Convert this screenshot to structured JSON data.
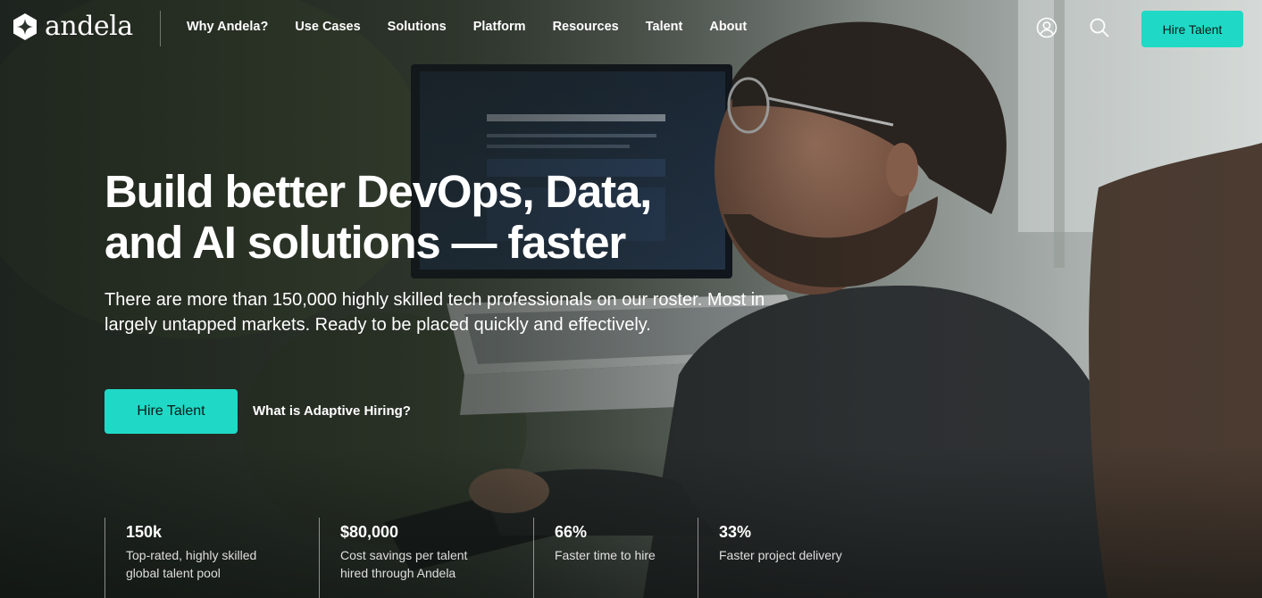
{
  "brand": {
    "name": "andela"
  },
  "nav": {
    "items": [
      "Why Andela?",
      "Use Cases",
      "Solutions",
      "Platform",
      "Resources",
      "Talent",
      "About"
    ]
  },
  "header": {
    "account_icon": "user-circle-icon",
    "search_icon": "search-icon",
    "cta_label": "Hire Talent"
  },
  "hero": {
    "title_line1": "Build better DevOps, Data,",
    "title_line2": "and AI solutions — faster",
    "subtitle_line1": "There are more than 150,000 highly skilled tech professionals on our roster. Most in",
    "subtitle_line2": "largely untapped markets. Ready to be placed quickly and effectively.",
    "cta_label": "Hire Talent",
    "link_label": "What is Adaptive Hiring?"
  },
  "stats": [
    {
      "value": "150k",
      "desc_line1": "Top-rated, highly skilled",
      "desc_line2": "global talent pool"
    },
    {
      "value": "$80,000",
      "desc_line1": "Cost savings per talent",
      "desc_line2": "hired through Andela"
    },
    {
      "value": "66%",
      "desc_line1": "Faster time to hire",
      "desc_line2": ""
    },
    {
      "value": "33%",
      "desc_line1": "Faster project delivery",
      "desc_line2": ""
    }
  ],
  "colors": {
    "accent": "#1fd9c6",
    "text": "#ffffff",
    "overlay": "#161c18"
  }
}
